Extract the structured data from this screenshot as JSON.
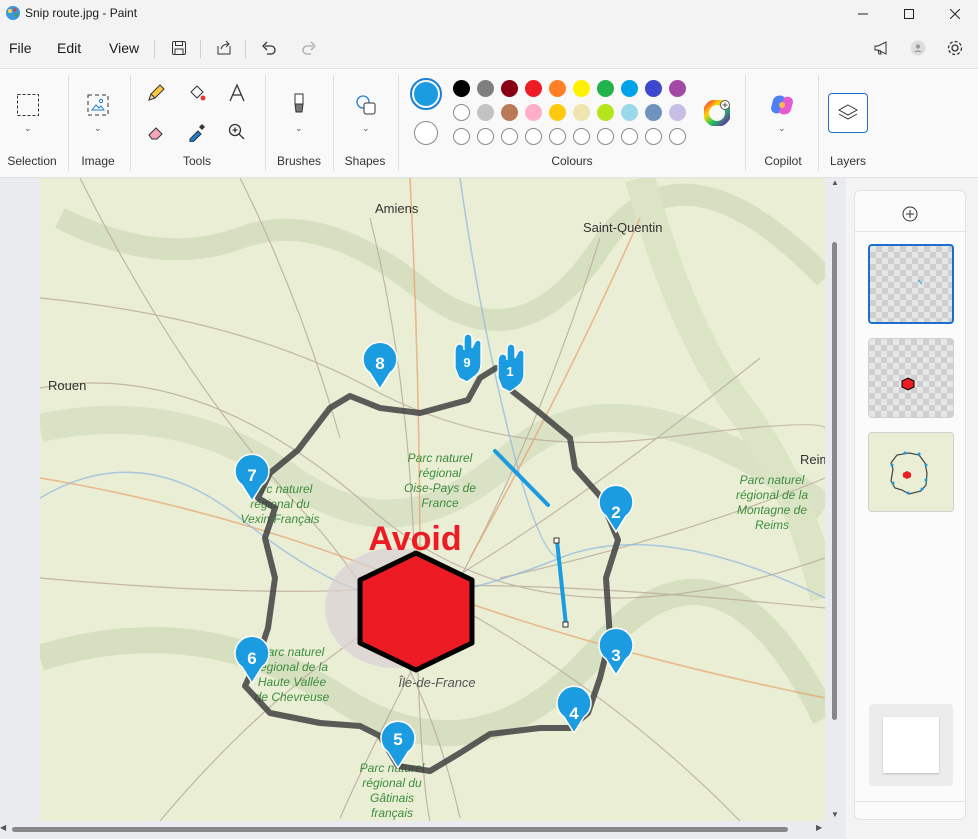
{
  "window": {
    "title": "Snip route.jpg - Paint"
  },
  "menu": {
    "file": "File",
    "edit": "Edit",
    "view": "View"
  },
  "ribbon": {
    "groups": {
      "selection": "Selection",
      "image": "Image",
      "tools": "Tools",
      "brushes": "Brushes",
      "shapes": "Shapes",
      "colours": "Colours",
      "copilot": "Copilot",
      "layers": "Layers"
    },
    "primary_color": "#1b9be0",
    "secondary_color": "#ffffff",
    "palette_row1": [
      "#000000",
      "#7f7f7f",
      "#880015",
      "#ed1c24",
      "#ff7f27",
      "#fff200",
      "#22b14c",
      "#00a2e8",
      "#3f48cc",
      "#a349a4"
    ],
    "palette_row2": [
      "#ffffff",
      "#c3c3c3",
      "#b97a57",
      "#ffaec9",
      "#ffc90e",
      "#efe4b0",
      "#b5e61d",
      "#99d9ea",
      "#7092be",
      "#c8bfe7"
    ]
  },
  "map": {
    "cities": [
      "Amiens",
      "Saint-Quentin",
      "Rouen",
      "Reims"
    ],
    "parks": [
      "Parc naturel régional Oise-Pays de France",
      "Parc naturel régional du Vexin Français",
      "Parc naturel régional de la Haute Vallée de Chevreuse",
      "Parc naturel régional du Gâtinais français",
      "Parc naturel régional de la Montagne de Reims"
    ],
    "region": "Île-de-France",
    "avoid_label": "Avoid",
    "markers": [
      "1",
      "2",
      "3",
      "4",
      "5",
      "6",
      "7",
      "8",
      "9"
    ]
  }
}
